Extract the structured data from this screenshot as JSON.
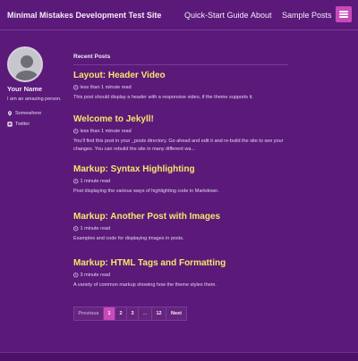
{
  "header": {
    "site_title": "Minimal Mistakes Development Test Site",
    "nav": [
      "Quick-Start Guide",
      "About",
      "Sample Posts"
    ],
    "menu_icon": "hamburger-menu-icon"
  },
  "sidebar": {
    "author_name": "Your Name",
    "author_bio": "I am an amazing person.",
    "links": [
      {
        "label": "Somewhere",
        "icon": "map-marker-icon"
      },
      {
        "label": "Twitter",
        "icon": "twitter-icon"
      }
    ]
  },
  "main": {
    "section_title": "Recent Posts",
    "posts": [
      {
        "title": "Layout: Header Video",
        "read_time": "less than 1 minute read",
        "excerpt": "This post should display a header with a responsive video, if the theme supports it."
      },
      {
        "title": "Welcome to Jekyll!",
        "read_time": "less than 1 minute read",
        "excerpt": "You’ll find this post in your _posts directory. Go ahead and edit it and re-build the site to see your changes. You can rebuild the site in many different wa..."
      },
      {
        "title": "Markup: Syntax Highlighting",
        "read_time": "1 minute read",
        "excerpt": "Post displaying the various ways of highlighting code in Markdown."
      },
      {
        "title": "Markup: Another Post with Images",
        "read_time": "1 minute read",
        "excerpt": "Examples and code for displaying images in posts."
      },
      {
        "title": "Markup: HTML Tags and Formatting",
        "read_time": "3 minute read",
        "excerpt": "A variety of common markup showing how the theme styles them."
      }
    ]
  },
  "pagination": {
    "previous": "Previous",
    "pages": [
      "1",
      "2",
      "3",
      "...",
      "12"
    ],
    "next": "Next",
    "current": "1"
  },
  "colors": {
    "background": "#5b1a7a",
    "title_accent": "#f7e66a",
    "button_accent": "#c94ab8"
  }
}
